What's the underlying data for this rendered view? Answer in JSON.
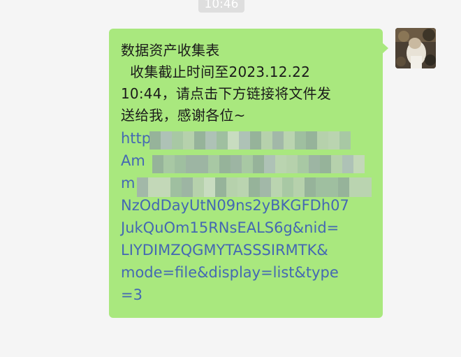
{
  "timestamp": "10:46",
  "message": {
    "text_lines": [
      "数据资产收集表",
      "  收集截止时间至2023.12.22",
      "10:44，请点击下方链接将文件发",
      "送给我，感谢各位~"
    ],
    "link_lines": [
      "http",
      "Am",
      "m",
      "NzOdDayUtN09ns2yBKGFDh07",
      "JukQuOm15RNsEALS6g&nid=",
      "LIYDIMZQGMYTASSSIRMTK&",
      "mode=file&display=list&type",
      "=3"
    ]
  },
  "colors": {
    "bubble": "#a9e87e",
    "link": "#4468b3",
    "background": "#f5f5f5"
  }
}
